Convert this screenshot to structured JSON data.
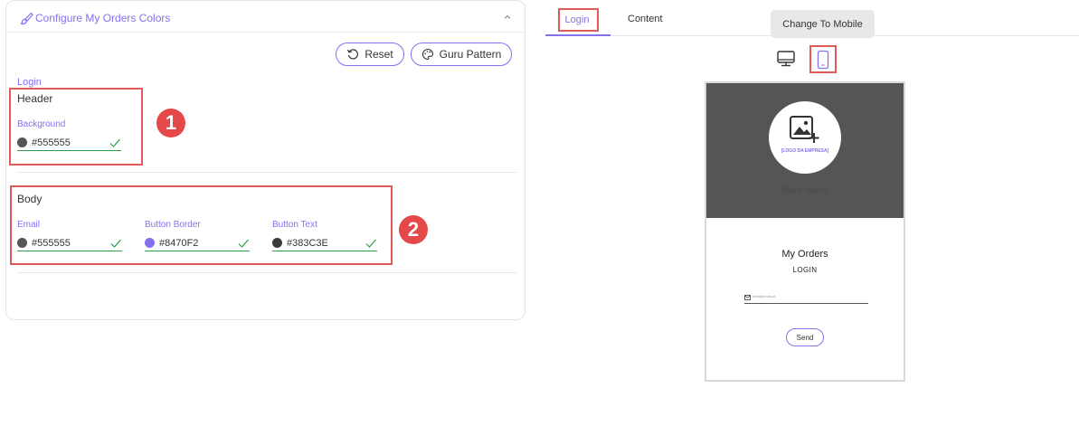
{
  "panel": {
    "title": "Configure My Orders Colors",
    "reset_label": "Reset",
    "guru_label": "Guru Pattern"
  },
  "login_section": {
    "label": "Login",
    "header": {
      "title": "Header",
      "fields": [
        {
          "label": "Background",
          "value": "#555555",
          "swatch": "#555555"
        }
      ]
    },
    "body": {
      "title": "Body",
      "fields": [
        {
          "label": "Email",
          "value": "#555555",
          "swatch": "#555555"
        },
        {
          "label": "Button Border",
          "value": "#8470F2",
          "swatch": "#8470F2"
        },
        {
          "label": "Button Text",
          "value": "#383C3E",
          "swatch": "#383C3E"
        }
      ]
    }
  },
  "callouts": [
    "1",
    "2"
  ],
  "preview": {
    "tabs": [
      {
        "label": "Login",
        "active": true
      },
      {
        "label": "Content",
        "active": false
      }
    ],
    "tooltip": "Change To Mobile",
    "devices": [
      "desktop-icon",
      "mobile-icon"
    ],
    "active_device": "mobile",
    "phone": {
      "logo_text": "[LOGO DA EMPRESA]",
      "store_name": "Store Name",
      "title": "My Orders",
      "subtitle": "LOGIN",
      "email_placeholder": "email@mail.pt",
      "send_label": "Send"
    }
  },
  "colors": {
    "accent": "#8470f2",
    "callout": "#e05a5a",
    "valid": "#2e9e4b",
    "phone_header": "#555555"
  }
}
